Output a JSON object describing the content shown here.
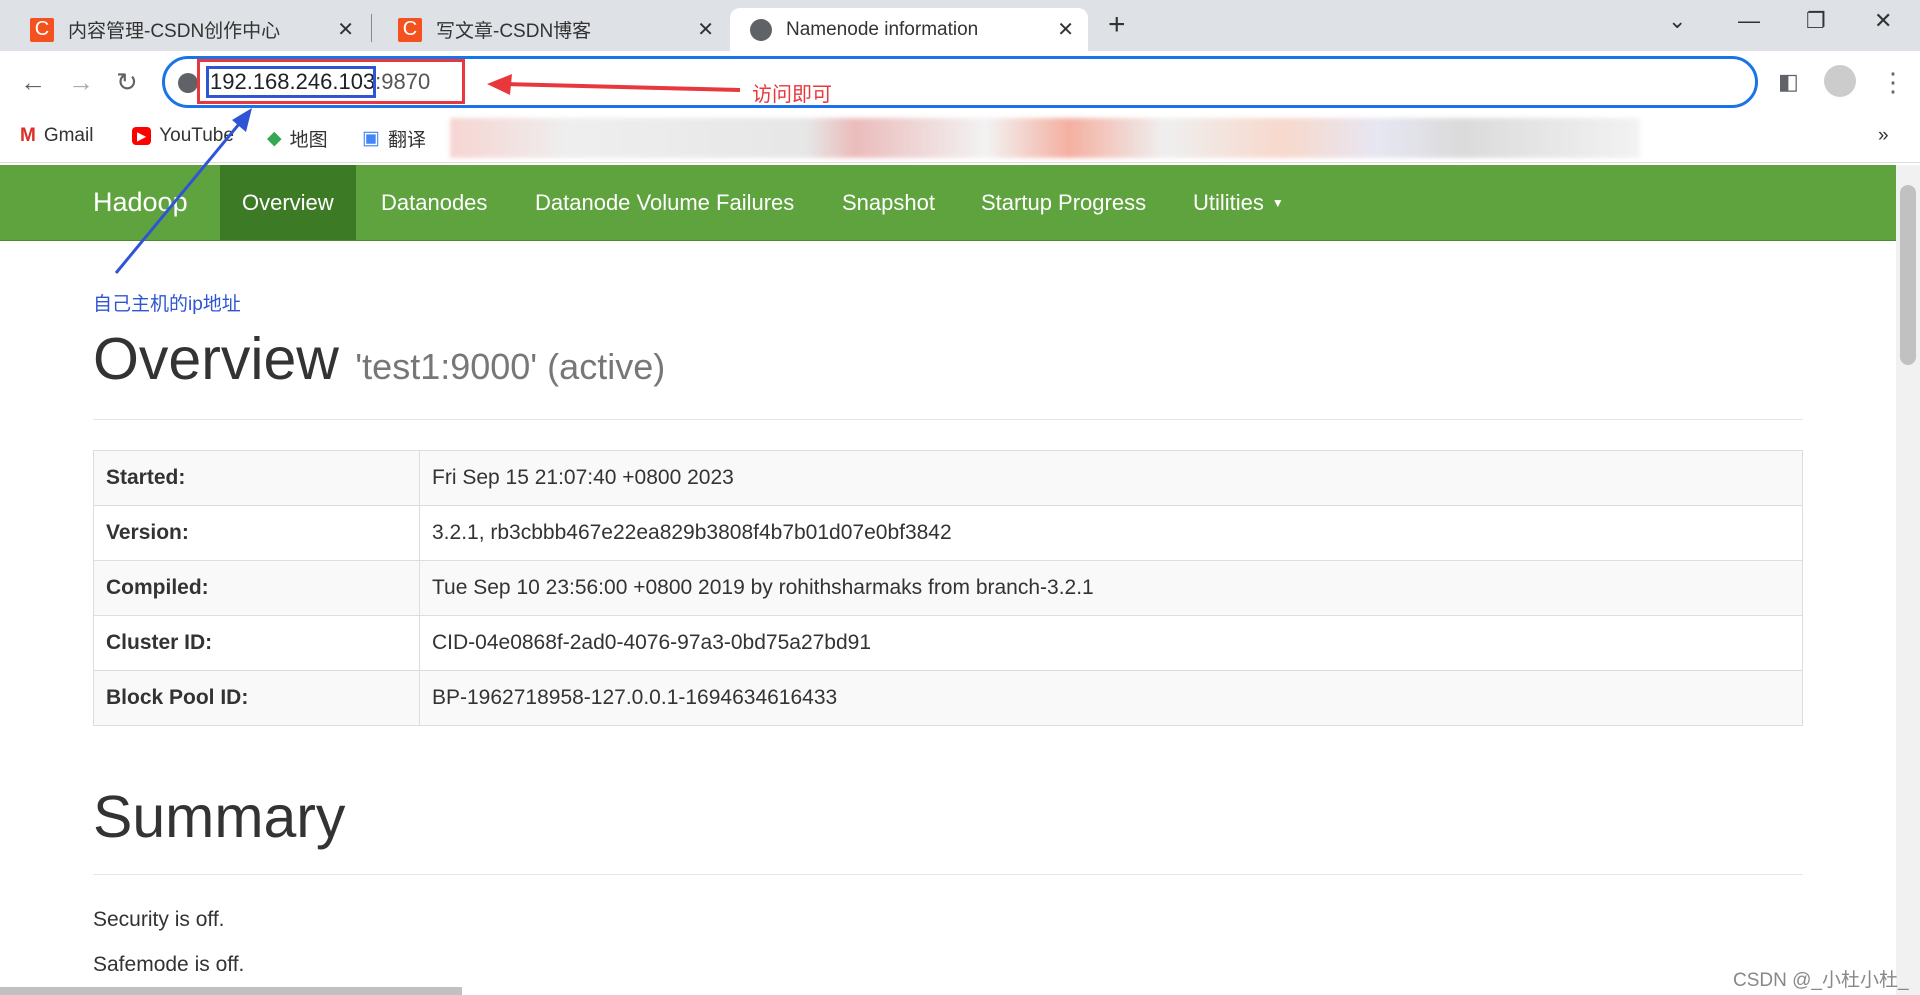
{
  "browser": {
    "tabs": [
      {
        "title": "内容管理-CSDN创作中心",
        "icon": "csdn-icon"
      },
      {
        "title": "写文章-CSDN博客",
        "icon": "csdn-icon"
      },
      {
        "title": "Namenode information",
        "icon": "globe-icon",
        "active": true
      }
    ],
    "url_host": "192.168.246.103",
    "url_port": ":9870",
    "bookmarks": [
      {
        "label": "Gmail"
      },
      {
        "label": "YouTube"
      },
      {
        "label": "地图"
      },
      {
        "label": "翻译"
      }
    ]
  },
  "navbar": {
    "brand": "Hadoop",
    "items": [
      "Overview",
      "Datanodes",
      "Datanode Volume Failures",
      "Snapshot",
      "Startup Progress",
      "Utilities"
    ],
    "active": "Overview",
    "color": "#5fa33e"
  },
  "overview": {
    "title": "Overview",
    "subtitle": "'test1:9000' (active)",
    "rows": [
      {
        "key": "Started:",
        "value": "Fri Sep 15 21:07:40 +0800 2023"
      },
      {
        "key": "Version:",
        "value": "3.2.1, rb3cbbb467e22ea829b3808f4b7b01d07e0bf3842"
      },
      {
        "key": "Compiled:",
        "value": "Tue Sep 10 23:56:00 +0800 2019 by rohithsharmaks from branch-3.2.1"
      },
      {
        "key": "Cluster ID:",
        "value": "CID-04e0868f-2ad0-4076-97a3-0bd75a27bd91"
      },
      {
        "key": "Block Pool ID:",
        "value": "BP-1962718958-127.0.0.1-1694634616433"
      }
    ]
  },
  "summary": {
    "title": "Summary",
    "lines": [
      "Security is off.",
      "Safemode is off."
    ]
  },
  "annotations": {
    "access": "访问即可",
    "ip_note": "自己主机的ip地址",
    "watermark": "CSDN @_小杜小杜_"
  }
}
